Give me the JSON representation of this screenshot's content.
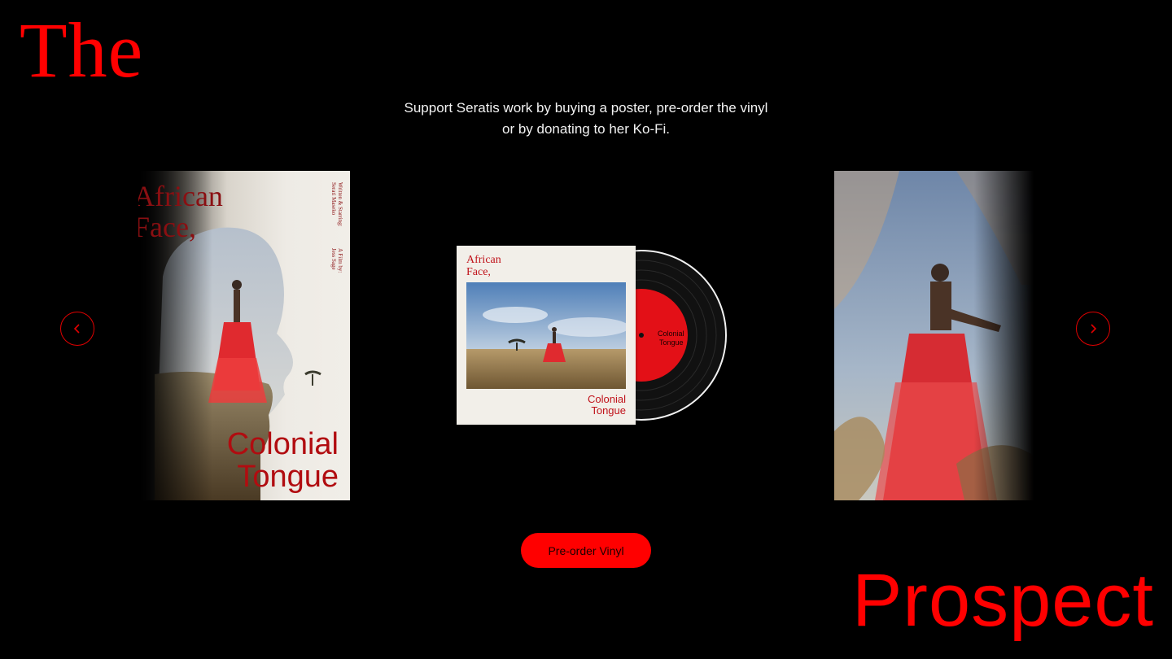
{
  "brand": {
    "line1": "The",
    "line2": "Prospect",
    "accent": "#ff0000"
  },
  "intro": {
    "line1": "Support Seratis work by buying a poster, pre-order the vinyl",
    "line2": "or by donating to her Ko-Fi."
  },
  "carousel": {
    "prev_icon": "chevron-left-icon",
    "next_icon": "chevron-right-icon",
    "poster_left": {
      "title_top_line1": "African",
      "title_top_line2": "Face,",
      "title_bottom_line1": "Colonial",
      "title_bottom_line2": "Tongue",
      "credit_line1": "Written & Starring:",
      "credit_line2": "Serati Maseko",
      "credit_line3": "A Film by:",
      "credit_line4": "Jess Sage"
    },
    "vinyl": {
      "title_top_line1": "African",
      "title_top_line2": "Face,",
      "title_bottom_line1": "Colonial",
      "title_bottom_line2": "Tongue",
      "label_line1": "Colonial",
      "label_line2": "Tongue"
    }
  },
  "cta": {
    "label": "Pre-order Vinyl"
  }
}
